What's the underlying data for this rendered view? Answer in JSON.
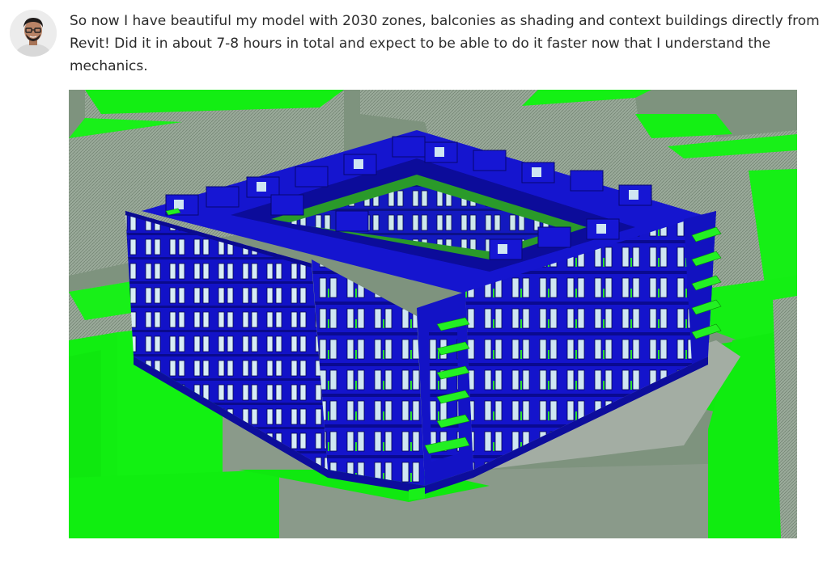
{
  "post": {
    "author_avatar_icon": "person-avatar-icon",
    "text": "So now I have beautiful my model with 2030 zones, balconies as shading and context buildings directly from Revit! Did it in about 7-8 hours in total and expect to be able to do it faster now that I understand the mechanics.",
    "attachment": {
      "kind": "3d-building-model-render",
      "colors": {
        "building": "#1010c8",
        "context": "#12f012",
        "ground": "#7f937f",
        "glazing": "#d8ecf4"
      }
    }
  }
}
